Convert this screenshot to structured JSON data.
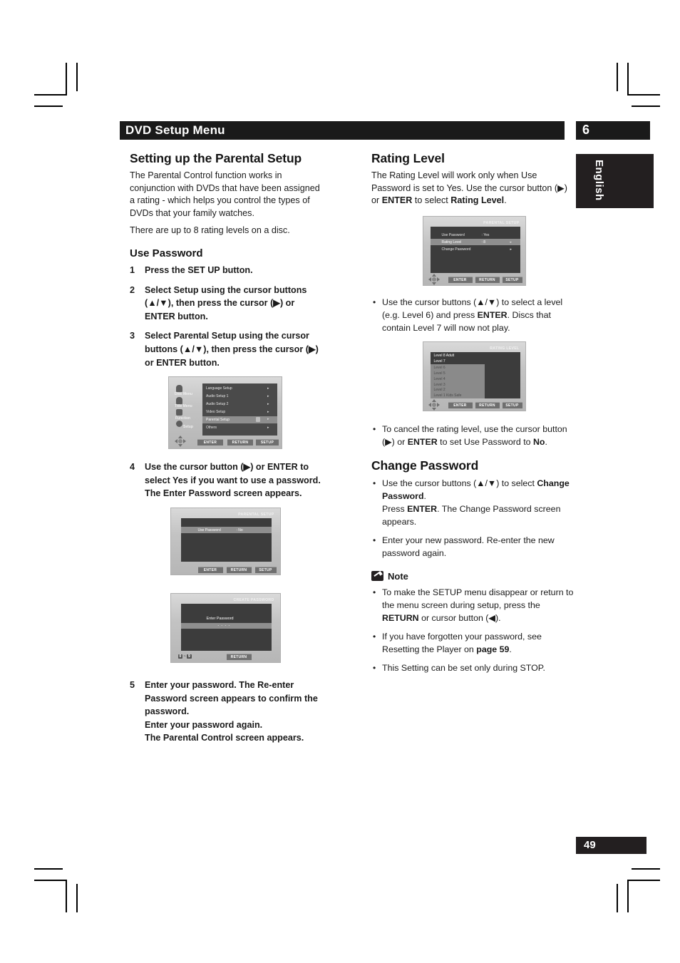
{
  "header": {
    "title": "DVD Setup Menu",
    "chapter": "6",
    "language_tab": "English",
    "page_number": "49"
  },
  "left_column": {
    "section_title": "Setting up the Parental Setup",
    "intro_p1": "The Parental Control function works in conjunction with DVDs that have been assigned a rating - which helps you control the types of DVDs that your family watches.",
    "intro_p2": "There are up to 8 rating levels on a disc.",
    "subsection_title": "Use Password",
    "steps": [
      {
        "num": "1",
        "text_html": "Press the SET UP button."
      },
      {
        "num": "2",
        "text_html": "Select <b>Setup</b> using the cursor buttons (▲/▼), then press the cursor (▶) or ENTER button."
      },
      {
        "num": "3",
        "text_html": "Select <b>Parental Setup</b> using the cursor buttons (▲/▼), then press the cursor (▶) or ENTER button."
      },
      {
        "num": "4",
        "text_html": "Use the cursor button (▶) or ENTER to select <b>Yes</b> if you want to use a password. The Enter Password screen appears."
      },
      {
        "num": "5",
        "text_html": "Enter your password. The Re-enter Password screen appears to confirm the password.<br>Enter your password again.<br>The Parental Control screen appears."
      }
    ]
  },
  "right_column": {
    "section_title": "Rating Level",
    "intro_html": "The Rating Level will work only when Use Password is set to Yes. Use the cursor button (▶) or <b>ENTER</b> to select <b>Rating Level</b>.",
    "bullet_select_level_html": "Use the cursor buttons (▲/▼) to select a level (e.g. Level 6) and press <b>ENTER</b>. Discs that contain Level 7 will now not play.",
    "bullet_cancel_html": "To cancel the rating level, use the cursor button (▶) or <b>ENTER</b> to set Use Password to <b>No</b>.",
    "change_password_title": "Change Password",
    "bullet_change_html": "Use the cursor buttons (▲/▼) to select <b>Change Password</b>.<br>Press <b>ENTER</b>. The Change Password screen appears.",
    "bullet_enter_new_html": "Enter your new password. Re-enter the new password again.",
    "note": {
      "title": "Note",
      "items_html": [
        "To make the SETUP menu disappear or return to the menu screen during setup, press the <b>RETURN</b> or cursor button (◀).",
        "If you have forgotten your password, see Resetting the Player on <b>page 59</b>.",
        "This Setting can be set only during STOP."
      ]
    }
  },
  "screenshots": {
    "setup_menu": {
      "sidebar": [
        "Disc Menu",
        "Title Menu",
        "Function",
        "Setup"
      ],
      "items": [
        "Language Setup",
        "Audio Setup 1",
        "Audio Setup 2",
        "Video Setup",
        "Parental Setup",
        "Others"
      ],
      "highlighted_item": "Parental Setup",
      "buttons": [
        "ENTER",
        "RETURN",
        "SETUP"
      ]
    },
    "parental_setup_no": {
      "caption": "PARENTAL SETUP",
      "rows": [
        {
          "label": "Use Password",
          "value": ": No",
          "highlight": true
        }
      ],
      "buttons": [
        "ENTER",
        "RETURN",
        "SETUP"
      ]
    },
    "create_password": {
      "caption": "CREATE PASSWORD",
      "prompt": "Enter Password",
      "entry": "- - - -",
      "numkey_from": "0",
      "numkey_to": "9",
      "numkey_sep": "~",
      "buttons": [
        "RETURN"
      ]
    },
    "parental_setup_yes": {
      "caption": "PARENTAL SETUP",
      "rows": [
        {
          "label": "Use Password",
          "value": ": Yes",
          "highlight": false
        },
        {
          "label": "Rating Level",
          "value": ": 8",
          "highlight": true
        },
        {
          "label": "Change Password",
          "value": "",
          "highlight": false
        }
      ],
      "buttons": [
        "ENTER",
        "RETURN",
        "SETUP"
      ]
    },
    "rating_level": {
      "caption": "RATING LEVEL",
      "levels": [
        "Level 8 Adult",
        "Level 7",
        "Level 6",
        "Level 5",
        "Level 4",
        "Level 3",
        "Level 2",
        "Level 1 Kids Safe"
      ],
      "buttons": [
        "ENTER",
        "RETURN",
        "SETUP"
      ]
    }
  },
  "colors": {
    "ink": "#1a1a1a",
    "bar": "#231f20",
    "paper": "#ffffff"
  }
}
